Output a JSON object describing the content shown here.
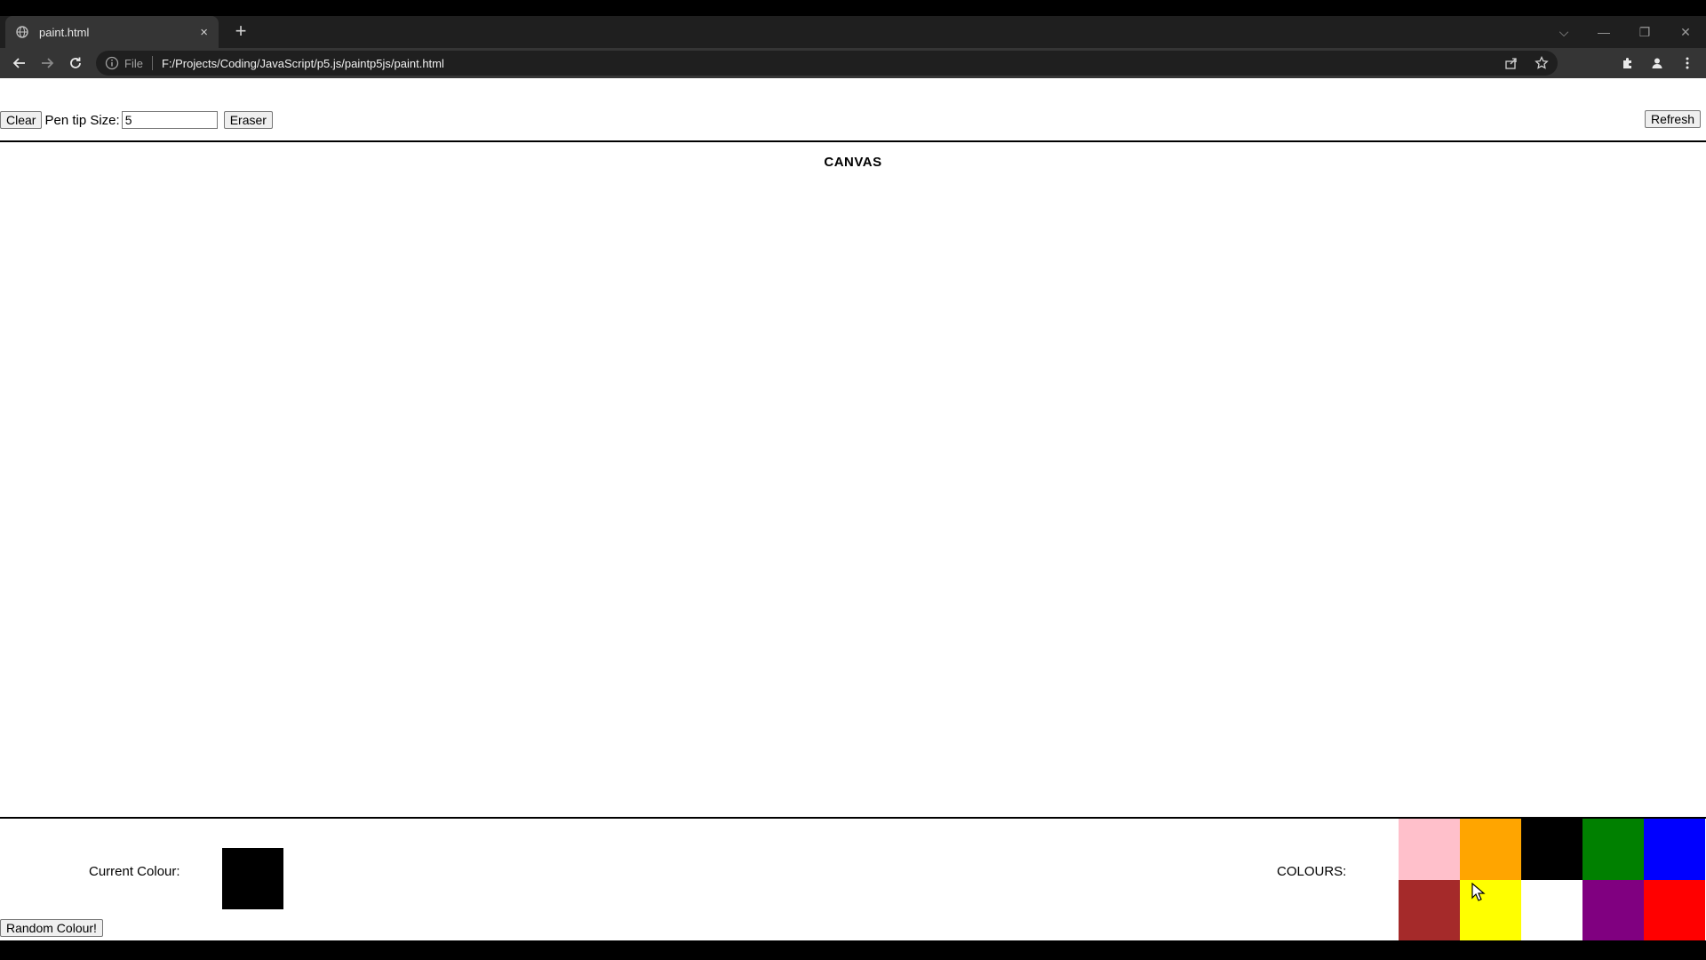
{
  "browser": {
    "tab": {
      "title": "paint.html",
      "close_glyph": "×",
      "icon": "globe-icon"
    },
    "new_tab_glyph": "+",
    "window_controls": {
      "tab_search": "⌵",
      "minimize": "—",
      "maximize": "❐",
      "close": "✕"
    },
    "address": {
      "scheme": "File",
      "url": "F:/Projects/Coding/JavaScript/p5.js/paintp5js/paint.html"
    }
  },
  "toolbar": {
    "clear_label": "Clear",
    "pen_size_label": "Pen tip Size:",
    "pen_size_value": "5",
    "eraser_label": "Eraser",
    "refresh_label": "Refresh"
  },
  "canvas": {
    "heading": "CANVAS"
  },
  "footer": {
    "current_colour_label": "Current Colour:",
    "current_colour": "#000000",
    "random_label": "Random Colour!",
    "colours_label": "COLOURS:",
    "palette": [
      {
        "name": "pink",
        "color": "#ffc0cb"
      },
      {
        "name": "orange",
        "color": "#ffa500"
      },
      {
        "name": "black",
        "color": "#000000"
      },
      {
        "name": "green",
        "color": "#008000"
      },
      {
        "name": "blue",
        "color": "#0000ff"
      },
      {
        "name": "brown",
        "color": "#a52a2a"
      },
      {
        "name": "yellow",
        "color": "#ffff00"
      },
      {
        "name": "white",
        "color": "#ffffff"
      },
      {
        "name": "purple",
        "color": "#800080"
      },
      {
        "name": "red",
        "color": "#ff0000"
      }
    ]
  }
}
